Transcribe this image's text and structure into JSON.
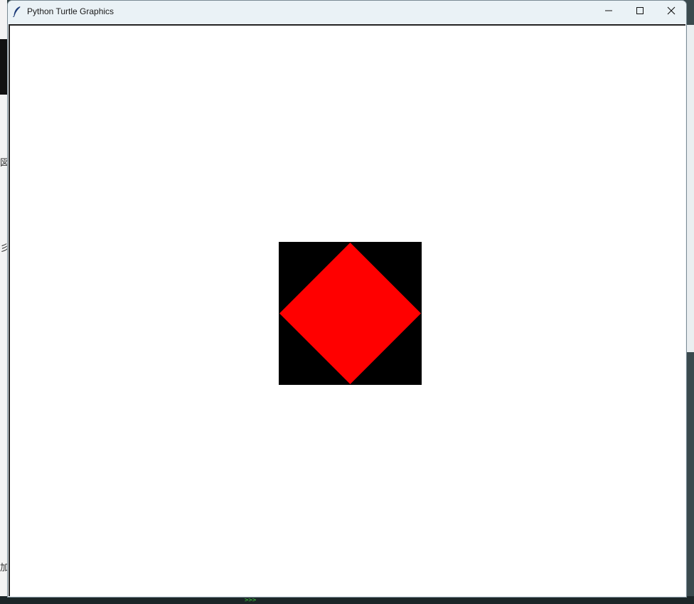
{
  "window": {
    "title": "Python Turtle Graphics",
    "icon": "feather-icon",
    "controls": {
      "minimize_icon": "minimize-icon",
      "maximize_icon": "maximize-icon",
      "close_icon": "close-icon"
    }
  },
  "canvas": {
    "background": "#ffffff",
    "shapes": [
      {
        "kind": "square",
        "fill": "#000000"
      },
      {
        "kind": "diamond",
        "fill": "#ff0000"
      }
    ]
  },
  "background_fragments": {
    "left_glyphs": [
      "図",
      "彡",
      "加"
    ],
    "shell_prompt": ">>>"
  }
}
